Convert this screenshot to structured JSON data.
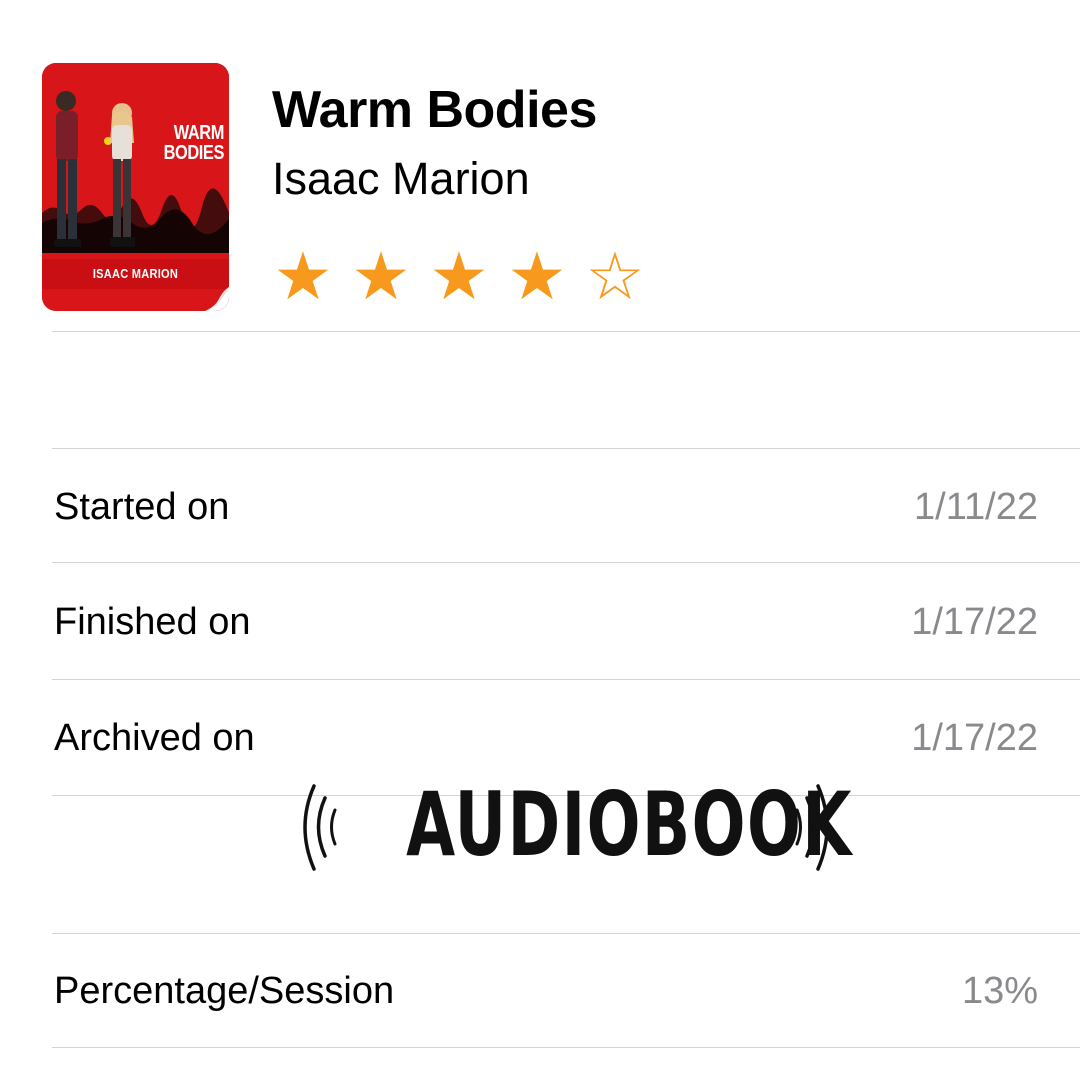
{
  "book": {
    "title": "Warm Bodies",
    "author": "Isaac Marion",
    "rating": 4,
    "rating_max": 5,
    "star_color": "#f7991c",
    "cover": {
      "title": "WARM BODIES",
      "author": "ISAAC MARION",
      "color": "#d8161a"
    }
  },
  "details": [
    {
      "label": "Started on",
      "value": "1/11/22"
    },
    {
      "label": "Finished on",
      "value": "1/17/22"
    },
    {
      "label": "Archived on",
      "value": "1/17/22"
    },
    {
      "label": "Percentage/Session",
      "value": "13%"
    }
  ],
  "overlay": {
    "text": "AUDIOBOOK",
    "icon": "sound-waves-icon"
  },
  "colors": {
    "secondary_text": "#8a8a8e",
    "separator": "#d4d4d6"
  }
}
